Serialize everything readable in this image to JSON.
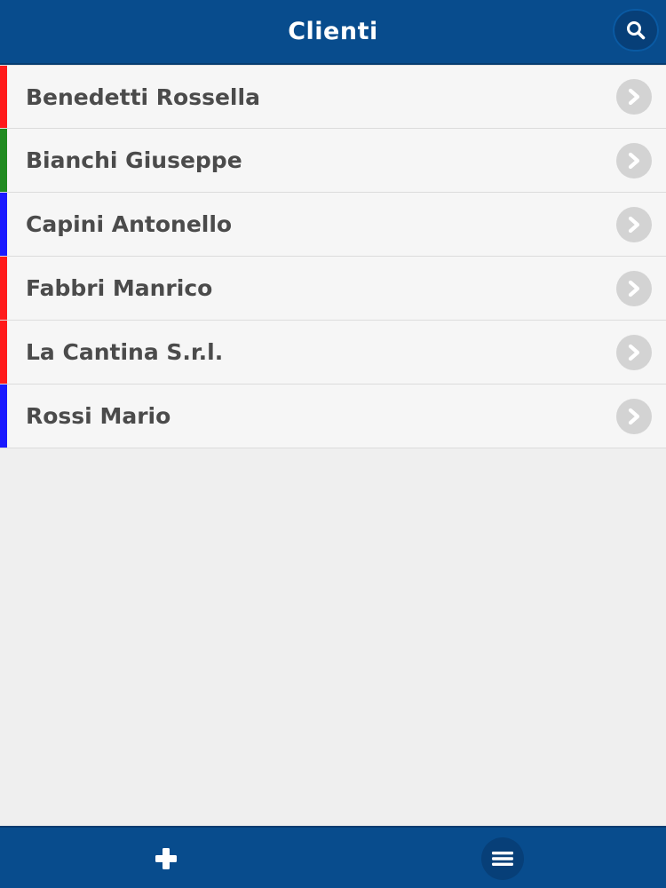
{
  "header": {
    "title": "Clienti",
    "search_icon": "search-icon"
  },
  "clients": [
    {
      "name": "Benedetti Rossella",
      "color": "#ff1a1a"
    },
    {
      "name": "Bianchi Giuseppe",
      "color": "#1f8a1f"
    },
    {
      "name": "Capini Antonello",
      "color": "#1a1aff"
    },
    {
      "name": "Fabbri Manrico",
      "color": "#ff1a1a"
    },
    {
      "name": "La Cantina S.r.l.",
      "color": "#ff1a1a"
    },
    {
      "name": "Rossi Mario",
      "color": "#1a1aff"
    }
  ],
  "footer": {
    "add_icon": "plus-icon",
    "menu_icon": "hamburger-menu-icon"
  },
  "colors": {
    "bar": "#084c8d",
    "background": "#efefef"
  }
}
